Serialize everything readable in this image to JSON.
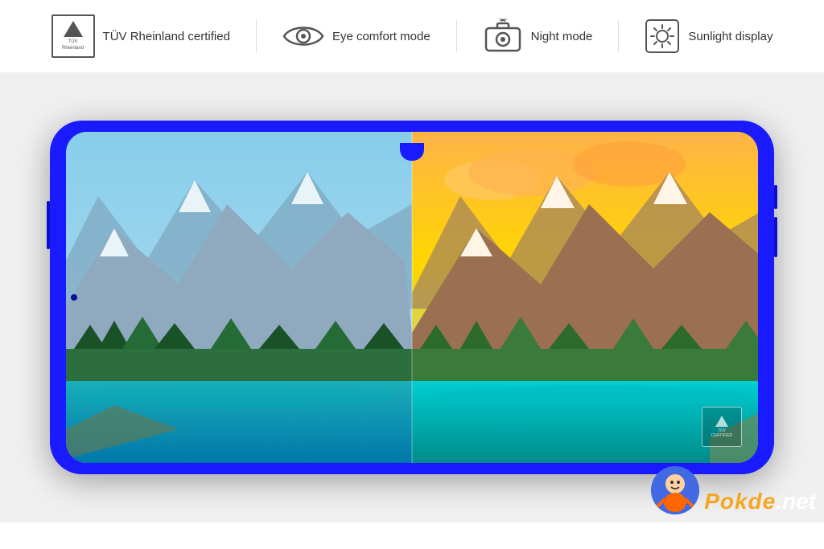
{
  "features": {
    "items": [
      {
        "id": "tuv",
        "icon": "tuv-icon",
        "label": "TÜV Rheinland certified",
        "icon_file": "icon-7.png"
      },
      {
        "id": "eye",
        "icon": "eye-icon",
        "label": "Eye comfort mode"
      },
      {
        "id": "night",
        "icon": "camera-icon",
        "label": "Night mode"
      },
      {
        "id": "sun",
        "icon": "sun-icon",
        "label": "Sunlight display"
      }
    ]
  },
  "phone": {
    "alt": "Smartphone showing split screen landscape comparison"
  },
  "watermark": {
    "brand": "Pokde",
    "dot": ".",
    "net": "net"
  }
}
